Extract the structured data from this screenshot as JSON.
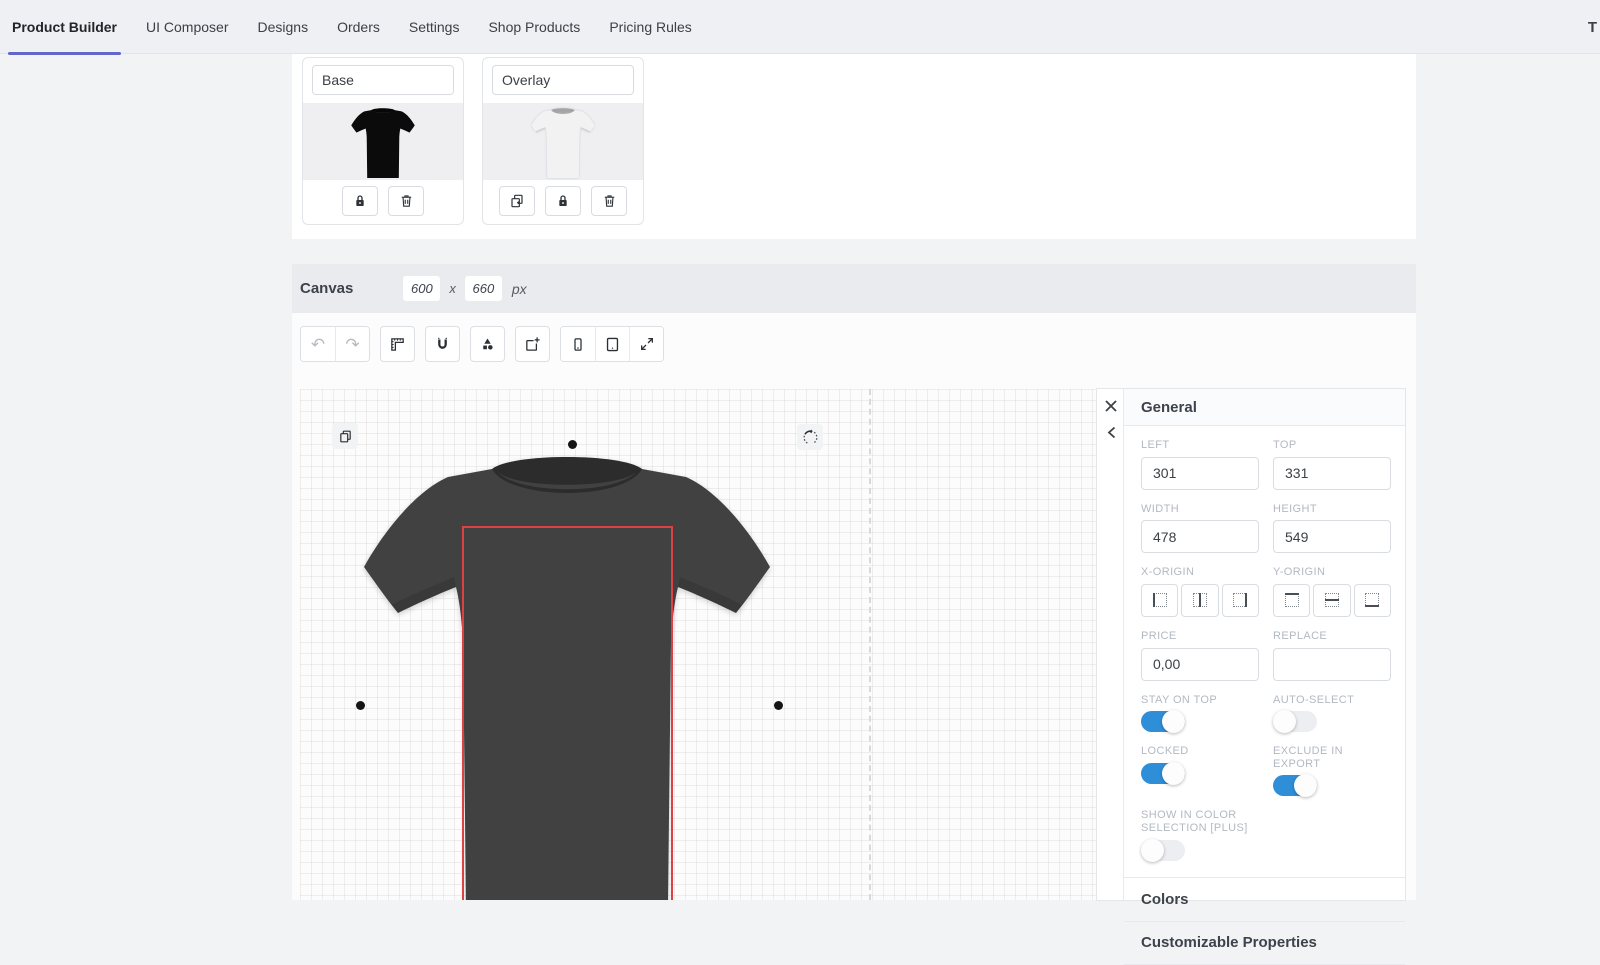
{
  "nav": {
    "tabs": [
      {
        "label": "Product Builder"
      },
      {
        "label": "UI Composer"
      },
      {
        "label": "Designs"
      },
      {
        "label": "Orders"
      },
      {
        "label": "Settings"
      },
      {
        "label": "Shop Products"
      },
      {
        "label": "Pricing Rules"
      }
    ],
    "active_tab": "Product Builder",
    "right_text": "T"
  },
  "layers": {
    "base": {
      "name_value": "Base"
    },
    "overlay": {
      "name_value": "Overlay"
    }
  },
  "canvas_bar": {
    "title": "Canvas",
    "width_value": "600",
    "separator": "x",
    "height_value": "660",
    "unit": "px"
  },
  "panel": {
    "title": "General",
    "left": {
      "label": "LEFT",
      "value": "301"
    },
    "top": {
      "label": "TOP",
      "value": "331"
    },
    "width": {
      "label": "WIDTH",
      "value": "478"
    },
    "height": {
      "label": "HEIGHT",
      "value": "549"
    },
    "x_origin": {
      "label": "X-ORIGIN"
    },
    "y_origin": {
      "label": "Y-ORIGIN"
    },
    "price": {
      "label": "PRICE",
      "value": "0,00"
    },
    "replace": {
      "label": "REPLACE",
      "value": ""
    },
    "stay_on_top": {
      "label": "STAY ON TOP",
      "on": true
    },
    "auto_select": {
      "label": "AUTO-SELECT",
      "on": false
    },
    "locked": {
      "label": "LOCKED",
      "on": true
    },
    "exclude_in_export": {
      "label": "EXCLUDE IN EXPORT",
      "on": true
    },
    "show_in_color_selection": {
      "label": "SHOW IN COLOR SELECTION [PLUS]",
      "on": false
    },
    "sections": {
      "colors": "Colors",
      "customizable_properties": "Customizable Properties"
    }
  },
  "icons": {
    "layer_actions": [
      "duplicate-icon",
      "lock-icon",
      "trash-icon"
    ],
    "toolbar": [
      "undo-icon",
      "redo-icon",
      "ruler-icon",
      "magnet-icon",
      "shapes-icon",
      "export-icon",
      "phone-icon",
      "tablet-icon",
      "expand-icon"
    ],
    "canvas_overlays": [
      "copy-icon",
      "rotate-icon",
      "selection-handle"
    ],
    "panel": [
      "close-icon",
      "chevron-left-icon",
      "origin-left-icon",
      "origin-center-icon",
      "origin-right-icon",
      "origin-top-icon",
      "origin-middle-icon",
      "origin-bottom-icon"
    ]
  },
  "colors": {
    "accent_blue": "#2f8ed8",
    "accent_purple": "#6267ce",
    "selection_red": "#dc4242",
    "shirt_dark": "#414141",
    "canvas_bar_bg": "#e9ebee"
  },
  "undo_glyph": "↶",
  "redo_glyph": "↷"
}
